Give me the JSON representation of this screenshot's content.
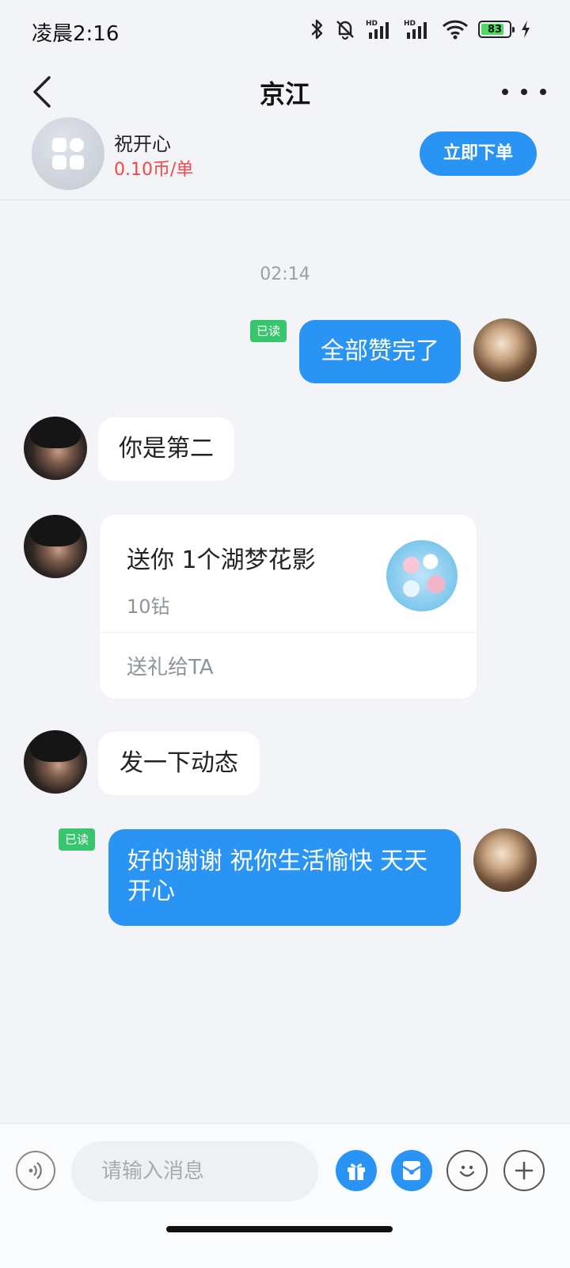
{
  "status_bar": {
    "time": "凌晨2:16",
    "battery": "83",
    "battery_level": 0.83
  },
  "nav": {
    "title": "京江"
  },
  "product": {
    "name": "祝开心",
    "price": "0.10币/单",
    "order_button": "立即下单"
  },
  "chat": {
    "timestamp": "02:14",
    "messages": [
      {
        "sender": "self",
        "text": "全部赞完了",
        "read_label": "已读"
      },
      {
        "sender": "other",
        "text": "你是第二"
      },
      {
        "sender": "other",
        "type": "gift",
        "title": "送你 1个湖梦花影",
        "price": "10钻",
        "action": "送礼给TA"
      },
      {
        "sender": "other",
        "text": "发一下动态"
      },
      {
        "sender": "self",
        "text": "好的谢谢 祝你生活愉快 天天开心",
        "read_label": "已读"
      }
    ]
  },
  "input_bar": {
    "placeholder": "请输入消息"
  },
  "colors": {
    "accent": "#2a94f4",
    "price_red": "#f2484a",
    "read_green": "#37c66e"
  }
}
